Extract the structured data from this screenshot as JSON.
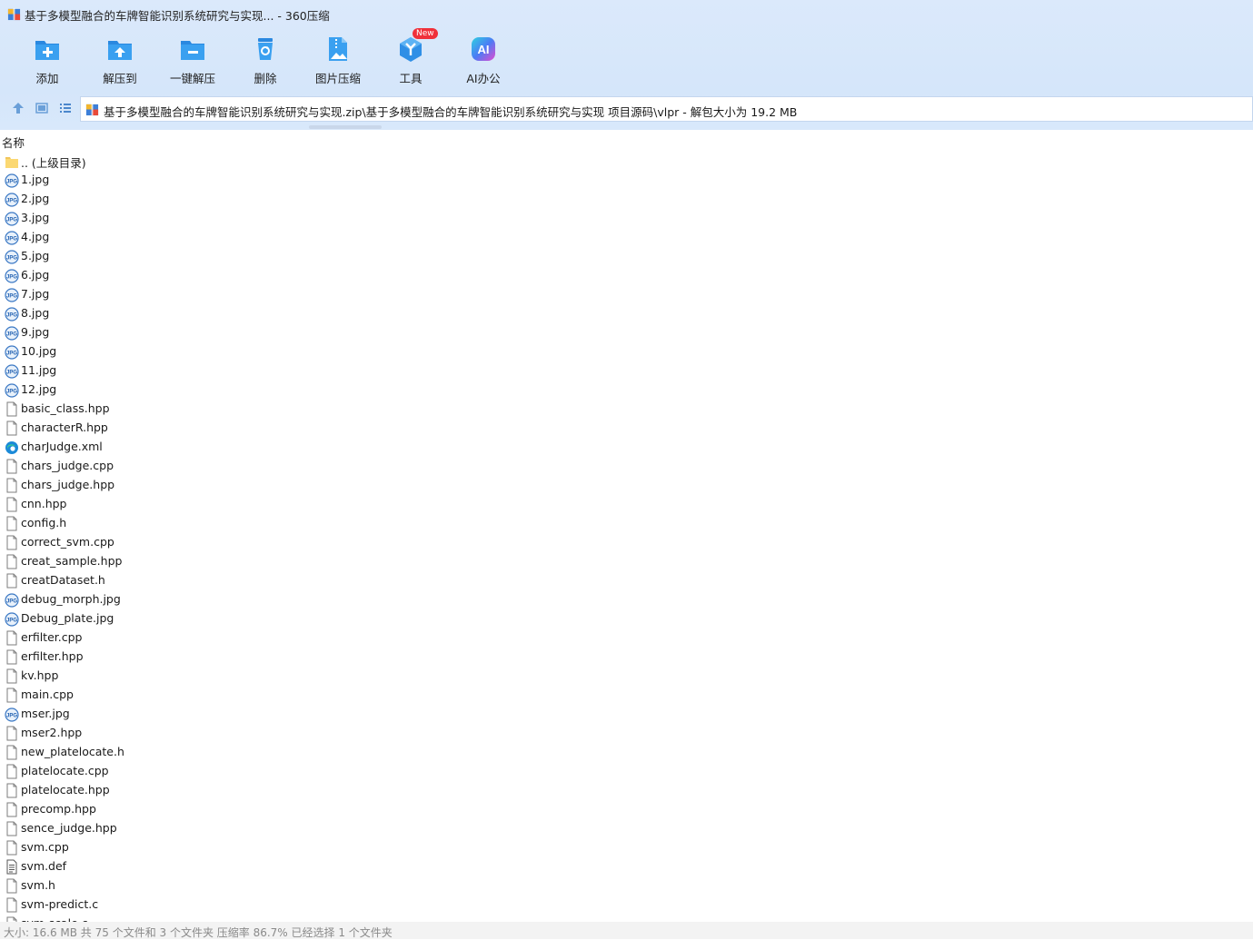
{
  "window": {
    "title": "基于多模型融合的车牌智能识别系统研究与实现... - 360压缩"
  },
  "toolbar": {
    "buttons": [
      {
        "label": "添加",
        "icon": "add-folder-icon"
      },
      {
        "label": "解压到",
        "icon": "extract-to-icon"
      },
      {
        "label": "一键解压",
        "icon": "one-click-extract-icon"
      },
      {
        "label": "删除",
        "icon": "recycle-delete-icon"
      },
      {
        "label": "图片压缩",
        "icon": "image-compress-icon"
      },
      {
        "label": "工具",
        "icon": "tools-cube-icon",
        "badge": "New"
      },
      {
        "label": "AI办公",
        "icon": "ai-office-icon"
      }
    ]
  },
  "address": {
    "path": "基于多模型融合的车牌智能识别系统研究与实现.zip\\基于多模型融合的车牌智能识别系统研究与实现 项目源码\\vlpr - 解包大小为 19.2 MB"
  },
  "list": {
    "column_name": "名称",
    "items": [
      {
        "name": ".. (上级目录)",
        "type": "folder"
      },
      {
        "name": "1.jpg",
        "type": "jpg"
      },
      {
        "name": "2.jpg",
        "type": "jpg"
      },
      {
        "name": "3.jpg",
        "type": "jpg"
      },
      {
        "name": "4.jpg",
        "type": "jpg"
      },
      {
        "name": "5.jpg",
        "type": "jpg"
      },
      {
        "name": "6.jpg",
        "type": "jpg"
      },
      {
        "name": "7.jpg",
        "type": "jpg"
      },
      {
        "name": "8.jpg",
        "type": "jpg"
      },
      {
        "name": "9.jpg",
        "type": "jpg"
      },
      {
        "name": "10.jpg",
        "type": "jpg"
      },
      {
        "name": "11.jpg",
        "type": "jpg"
      },
      {
        "name": "12.jpg",
        "type": "jpg"
      },
      {
        "name": "basic_class.hpp",
        "type": "file"
      },
      {
        "name": "characterR.hpp",
        "type": "file"
      },
      {
        "name": "charJudge.xml",
        "type": "xml"
      },
      {
        "name": "chars_judge.cpp",
        "type": "file"
      },
      {
        "name": "chars_judge.hpp",
        "type": "file"
      },
      {
        "name": "cnn.hpp",
        "type": "file"
      },
      {
        "name": "config.h",
        "type": "file"
      },
      {
        "name": "correct_svm.cpp",
        "type": "file"
      },
      {
        "name": "creat_sample.hpp",
        "type": "file"
      },
      {
        "name": "creatDataset.h",
        "type": "file"
      },
      {
        "name": "debug_morph.jpg",
        "type": "jpg"
      },
      {
        "name": "Debug_plate.jpg",
        "type": "jpg"
      },
      {
        "name": "erfilter.cpp",
        "type": "file"
      },
      {
        "name": "erfilter.hpp",
        "type": "file"
      },
      {
        "name": "kv.hpp",
        "type": "file"
      },
      {
        "name": "main.cpp",
        "type": "file"
      },
      {
        "name": "mser.jpg",
        "type": "jpg"
      },
      {
        "name": "mser2.hpp",
        "type": "file"
      },
      {
        "name": "new_platelocate.h",
        "type": "file"
      },
      {
        "name": "platelocate.cpp",
        "type": "file"
      },
      {
        "name": "platelocate.hpp",
        "type": "file"
      },
      {
        "name": "precomp.hpp",
        "type": "file"
      },
      {
        "name": "sence_judge.hpp",
        "type": "file"
      },
      {
        "name": "svm.cpp",
        "type": "file"
      },
      {
        "name": "svm.def",
        "type": "text"
      },
      {
        "name": "svm.h",
        "type": "file"
      },
      {
        "name": "svm-predict.c",
        "type": "file"
      },
      {
        "name": "svm-scale.c",
        "type": "file"
      }
    ]
  },
  "status": {
    "text": "大小: 16.6 MB 共 75 个文件和 3 个文件夹 压缩率 86.7% 已经选择 1 个文件夹"
  },
  "colors": {
    "chrome_bg": "#d5e6fa",
    "accent_blue": "#2f8fe6",
    "badge_red": "#f0303a"
  }
}
